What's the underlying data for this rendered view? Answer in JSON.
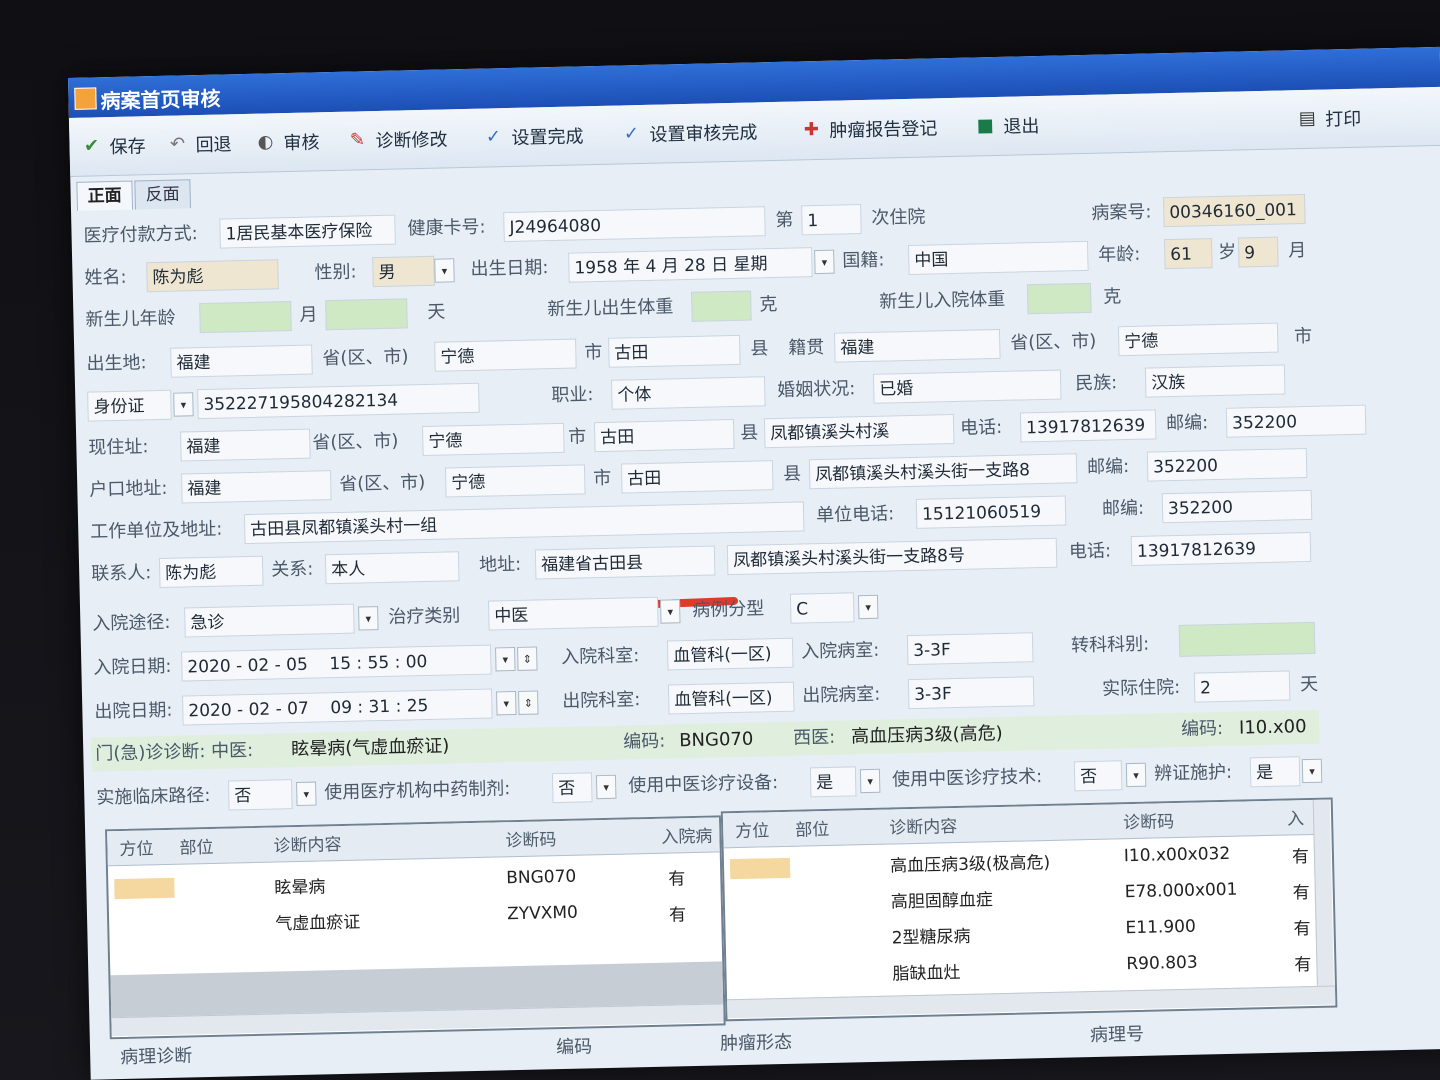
{
  "window": {
    "title": "病案首页审核"
  },
  "toolbar": {
    "save": "保存",
    "rollback": "回退",
    "review": "审核",
    "diag_edit": "诊断修改",
    "set_done": "设置完成",
    "set_review_done": "设置审核完成",
    "tumor_report": "肿瘤报告登记",
    "exit": "退出",
    "print": "打印"
  },
  "tabs": {
    "front": "正面",
    "back": "反面"
  },
  "form": {
    "pay_label": "医疗付款方式:",
    "pay_value": "1居民基本医疗保险",
    "card_label": "健康卡号:",
    "card_value": "J24964080",
    "nth_label": "第",
    "nth_value": "1",
    "nth_suffix": "次住院",
    "record_label": "病案号:",
    "record_value": "00346160_001",
    "name_label": "姓名:",
    "name_value": "陈为彪",
    "sex_label": "性别:",
    "sex_value": "男",
    "birth_label": "出生日期:",
    "birth_value": "1958 年 4 月 28 日",
    "weekday_label": "星期",
    "nation_label": "国籍:",
    "nation_value": "中国",
    "age_label": "年龄:",
    "age_value": "61",
    "age_year": "岁",
    "age_month_value": "9",
    "age_month": "月",
    "infant_age_label": "新生儿年龄",
    "month": "月",
    "day": "天",
    "nb_weight_label": "新生儿出生体重",
    "gram": "克",
    "nb_admit_weight_label": "新生儿入院体重",
    "gram2": "克",
    "birthplace_label": "出生地:",
    "birthplace_prov": "福建",
    "prov_label": "省(区、市)",
    "birthplace_city": "宁德",
    "city_label": "市",
    "birthplace_county": "古田",
    "county_label": "县",
    "native_label": "籍贯",
    "native_prov": "福建",
    "native_prov_label": "省(区、市)",
    "native_city": "宁德",
    "native_city_label": "市",
    "id_type": "身份证",
    "id_value": "352227195804282134",
    "job_label": "职业:",
    "job_value": "个体",
    "marital_label": "婚姻状况:",
    "marital_value": "已婚",
    "ethnic_label": "民族:",
    "ethnic_value": "汉族",
    "cur_addr_label": "现住址:",
    "cur_prov": "福建",
    "cur_prov_label": "省(区、市)",
    "cur_city": "宁德",
    "cur_city_label": "市",
    "cur_county": "古田",
    "cur_county_label": "县",
    "cur_detail": "凤都镇溪头村溪",
    "phone_label": "电话:",
    "phone_value": "13917812639",
    "zip_label": "邮编:",
    "zip_value": "352200",
    "hukou_label": "户口地址:",
    "hukou_prov": "福建",
    "hukou_prov_label": "省(区、市)",
    "hukou_city": "宁德",
    "hukou_city_label": "市",
    "hukou_county": "古田",
    "hukou_county_label": "县",
    "hukou_detail": "凤都镇溪头村溪头街一支路8",
    "hukou_zip_label": "邮编:",
    "hukou_zip": "352200",
    "work_label": "工作单位及地址:",
    "work_value": "古田县凤都镇溪头村一组",
    "work_phone_label": "单位电话:",
    "work_phone": "15121060519",
    "work_zip_label": "邮编:",
    "work_zip": "352200",
    "contact_label": "联系人:",
    "contact_value": "陈为彪",
    "relation_label": "关系:",
    "relation_value": "本人",
    "contact_addr_label": "地址:",
    "contact_addr": "福建省古田县",
    "contact_addr2": "凤都镇溪头村溪头街一支路8号",
    "contact_phone_label": "电话:",
    "contact_phone": "13917812639",
    "route_label": "入院途径:",
    "route_value": "急诊",
    "treat_label": "治疗类别",
    "treat_value": "中医",
    "case_type_label": "病例分型",
    "case_type_value": "C",
    "admit_date_label": "入院日期:",
    "admit_date": "2020 - 02 - 05",
    "admit_time": "15 : 55 : 00",
    "admit_dept_label": "入院科室:",
    "admit_dept": "血管科(一区)",
    "admit_ward_label": "入院病室:",
    "admit_ward": "3-3F",
    "transfer_label": "转科科别:",
    "disc_date_label": "出院日期:",
    "disc_date": "2020 - 02 - 07",
    "disc_time": "09 : 31 : 25",
    "disc_dept_label": "出院科室:",
    "disc_dept": "血管科(一区)",
    "disc_ward_label": "出院病室:",
    "disc_ward": "3-3F",
    "stay_label": "实际住院:",
    "stay_value": "2",
    "stay_unit": "天",
    "op_diag_label": "门(急)诊诊断: 中医:",
    "op_diag_tcm": "眩晕病(气虚血瘀证)",
    "op_code_label": "编码:",
    "op_code_tcm": "BNG070",
    "west_label": "西医:",
    "op_diag_west": "高血压病3级(高危)",
    "op_code_label2": "编码:",
    "op_code_west": "I10.x00",
    "path_label": "实施临床路径:",
    "path_value": "否",
    "herbal_label": "使用医疗机构中药制剂:",
    "herbal_value": "否",
    "device_label": "使用中医诊疗设备:",
    "device_value": "是",
    "tech_label": "使用中医诊疗技术:",
    "tech_value": "否",
    "nursing_label": "辨证施护:",
    "nursing_value": "是"
  },
  "tcm_grid": {
    "headers": [
      "方位",
      "部位",
      "诊断内容",
      "诊断码",
      "入院病"
    ],
    "rows": [
      {
        "content": "眩晕病",
        "code": "BNG070",
        "status": "有"
      },
      {
        "content": "气虚血瘀证",
        "code": "ZYVXM0",
        "status": "有"
      }
    ]
  },
  "west_grid": {
    "headers": [
      "方位",
      "部位",
      "诊断内容",
      "诊断码",
      "入"
    ],
    "rows": [
      {
        "content": "高血压病3级(极高危)",
        "code": "I10.x00x032",
        "status": "有"
      },
      {
        "content": "高胆固醇血症",
        "code": "E78.000x001",
        "status": "有"
      },
      {
        "content": "2型糖尿病",
        "code": "E11.900",
        "status": "有"
      },
      {
        "content": "脂缺血灶",
        "code": "R90.803",
        "status": "有"
      }
    ]
  },
  "bottom": {
    "pathology": "病理诊断",
    "code": "编码",
    "tumor_form": "肿瘤形态",
    "path_no": "病理号"
  }
}
